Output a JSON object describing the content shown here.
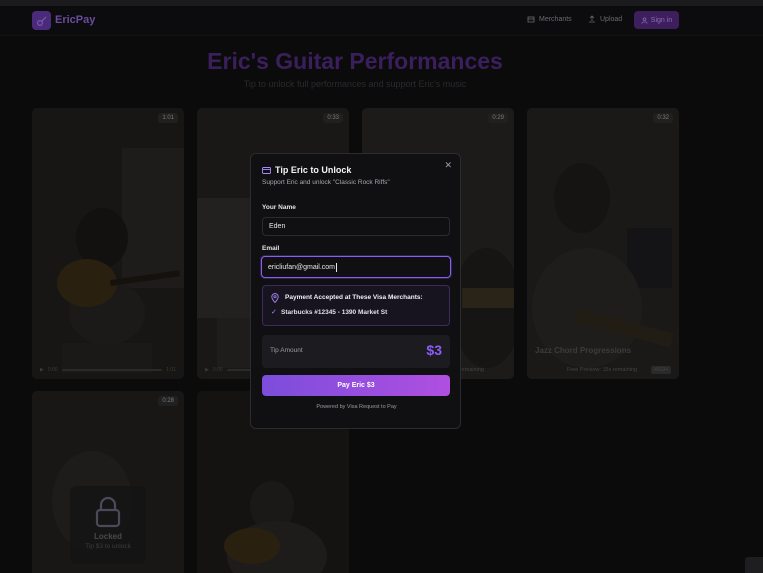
{
  "app": {
    "brand": "EricPay",
    "nav": {
      "merchants": "Merchants",
      "upload": "Upload",
      "signin": "Sign in"
    }
  },
  "hero": {
    "title": "Eric's Guitar Performances",
    "subtitle": "Tip to unlock full performances and support Eric's music"
  },
  "videos": [
    {
      "duration": "1:01",
      "time_current": "0:00",
      "time_total": "1:01"
    },
    {
      "duration": "0:33",
      "time_current": "0:00"
    },
    {
      "duration": "0:29",
      "meta": "remaining"
    },
    {
      "duration": "0:32",
      "title": "Jazz Chord Progressions",
      "meta": "Free Preview: 15s remaining",
      "badge": "HIGH"
    },
    {
      "duration": "0:28",
      "locked_title": "Locked",
      "locked_sub": "Tip $3 to unlock"
    },
    {
      "duration": ""
    }
  ],
  "modal": {
    "title": "Tip Eric to Unlock",
    "subtitle": "Support Eric and unlock \"Classic Rock Riffs\"",
    "name_label": "Your Name",
    "name_value": "Eden",
    "email_label": "Email",
    "email_value": "ericliufan@gmail.com",
    "merchants_heading": "Payment Accepted at These Visa Merchants:",
    "merchant_item": "Starbucks #12345 - 1390 Market St",
    "tip_label": "Tip Amount",
    "tip_value": "$3",
    "pay_button": "Pay Eric $3",
    "powered_by": "Powered by Visa Request to Pay"
  },
  "colors": {
    "accent": "#8b5cf6",
    "accent_gradient_end": "#b04fe0",
    "background": "#0b0b0c",
    "modal_bg": "#101012"
  }
}
